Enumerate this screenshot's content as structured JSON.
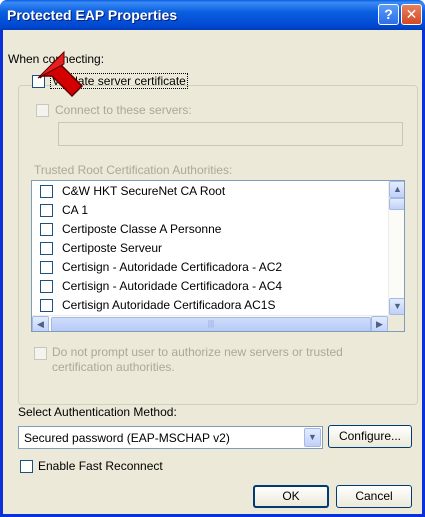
{
  "window": {
    "title": "Protected EAP Properties",
    "help_glyph": "?",
    "close_glyph": "✕"
  },
  "when_connecting": {
    "label": "When connecting:",
    "validate_cert_label": "Validate server certificate",
    "validate_cert_checked": false,
    "connect_servers_label": "Connect to these servers:",
    "connect_servers_value": "",
    "trusted_root_label": "Trusted Root Certification Authorities:",
    "ca_list": [
      {
        "label": "C&W HKT SecureNet CA Root",
        "checked": false
      },
      {
        "label": "CA 1",
        "checked": false
      },
      {
        "label": "Certiposte Classe A Personne",
        "checked": false
      },
      {
        "label": "Certiposte Serveur",
        "checked": false
      },
      {
        "label": "Certisign - Autoridade Certificadora - AC2",
        "checked": false
      },
      {
        "label": "Certisign - Autoridade Certificadora - AC4",
        "checked": false
      },
      {
        "label": "Certisign Autoridade Certificadora AC1S",
        "checked": false
      }
    ],
    "do_not_prompt_label_line1": "Do not prompt user to authorize new servers or trusted",
    "do_not_prompt_label_line2": "certification authorities."
  },
  "auth": {
    "label": "Select Authentication Method:",
    "selected_method": "Secured password (EAP-MSCHAP v2)",
    "configure_label": "Configure...",
    "fast_reconnect_label": "Enable Fast Reconnect",
    "fast_reconnect_checked": false
  },
  "footer": {
    "ok_label": "OK",
    "cancel_label": "Cancel"
  },
  "colors": {
    "annotation_arrow": "#d40000",
    "titlebar_blue": "#0a5fe0",
    "dialog_bg": "#ece9d8"
  }
}
